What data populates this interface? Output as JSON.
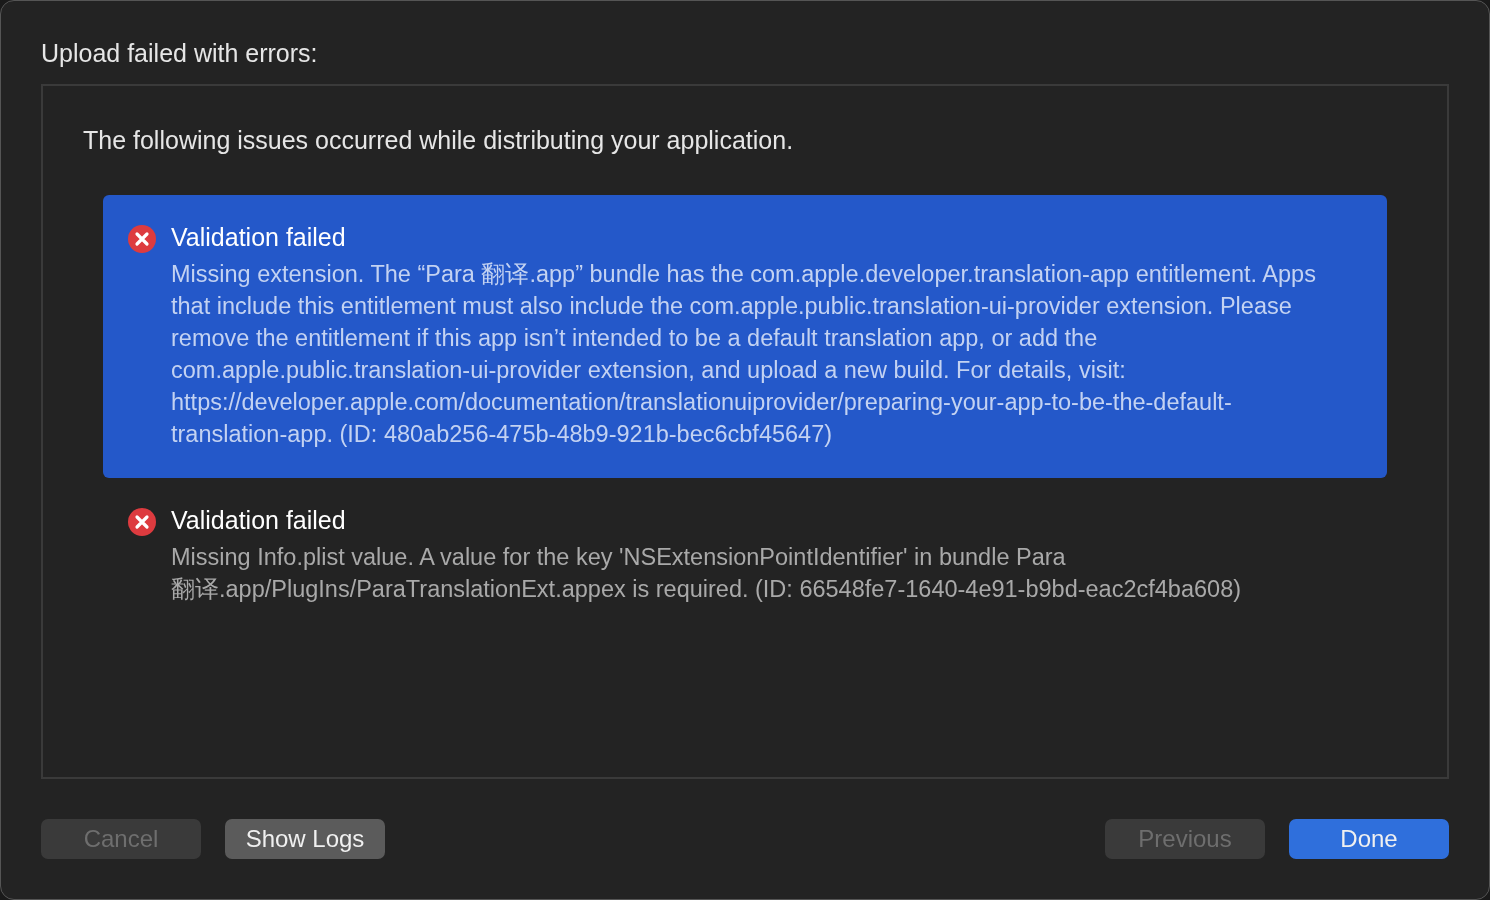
{
  "title": "Upload failed with errors:",
  "intro": "The following issues occurred while distributing your application.",
  "issues": [
    {
      "title": "Validation failed",
      "message": "Missing extension. The “Para 翻译.app” bundle has the com.apple.developer.translation-app entitlement. Apps that include this entitlement must also include the com.apple.public.translation-ui-provider extension. Please remove the entitlement if this app isn’t intended to be a default translation app, or add the com.apple.public.translation-ui-provider extension, and upload a new build. For details, visit: https://developer.apple.com/documentation/translationuiprovider/preparing-your-app-to-be-the-default-translation-app. (ID: 480ab256-475b-48b9-921b-bec6cbf45647)",
      "selected": true
    },
    {
      "title": "Validation failed",
      "message": "Missing Info.plist value. A value for the key 'NSExtensionPointIdentifier' in bundle Para 翻译.app/PlugIns/ParaTranslationExt.appex is required. (ID: 66548fe7-1640-4e91-b9bd-eac2cf4ba608)",
      "selected": false
    }
  ],
  "buttons_left": [
    {
      "label": "Cancel",
      "kind": "secondary",
      "disabled": true
    },
    {
      "label": "Show Logs",
      "kind": "secondary",
      "disabled": false
    }
  ],
  "buttons_right": [
    {
      "label": "Previous",
      "kind": "secondary",
      "disabled": true
    },
    {
      "label": "Done",
      "kind": "primary",
      "disabled": false
    }
  ]
}
